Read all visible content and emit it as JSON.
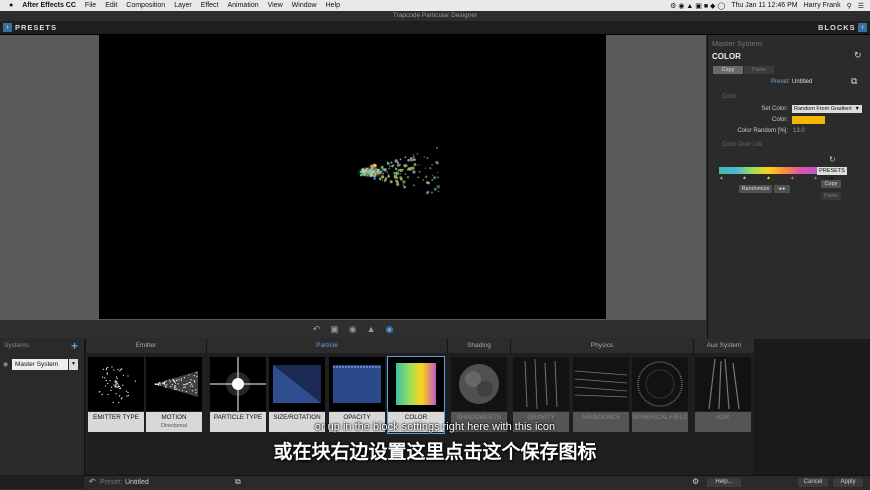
{
  "menubar": {
    "apple": "",
    "app_name": "After Effects CC",
    "items": [
      "File",
      "Edit",
      "Composition",
      "Layer",
      "Effect",
      "Animation",
      "View",
      "Window",
      "Help"
    ],
    "clock": "Thu Jan 11  12:46 PM",
    "user": "Harry Frank"
  },
  "window": {
    "title": "Trapcode Particular Designer"
  },
  "header": {
    "presets_label": "PRESETS",
    "blocks_label": "BLOCKS"
  },
  "right_panel": {
    "system_title": "Master System",
    "section_title": "COLOR",
    "copy_label": "Copy",
    "paste_label": "Paste",
    "preset_label": "Preset:",
    "preset_value": "Untitled",
    "color_section": "Color",
    "set_color_label": "Set Color:",
    "set_color_value": "Random From Gradient",
    "color_label": "Color:",
    "color_swatch": "#f2b705",
    "color_random_label": "Color Random [%]:",
    "color_random_value": "13.0",
    "col_over_life": "Color Over Life",
    "presets_dropdown": "PRESETS",
    "copy2_label": "Copy",
    "paste2_label": "Paste",
    "randomize_label": "Randomize",
    "swap_label": "◂ ▸"
  },
  "systems": {
    "title": "Systems",
    "add": "+",
    "item": "Master System"
  },
  "groups": [
    {
      "label": "Emitter"
    },
    {
      "label": "Particle"
    },
    {
      "label": "Shading"
    },
    {
      "label": "Physics"
    },
    {
      "label": "Aux System"
    }
  ],
  "blocks": [
    {
      "name": "EMITTER TYPE",
      "sub": ""
    },
    {
      "name": "MOTION",
      "sub": "Directional"
    },
    {
      "name": "PARTICLE TYPE",
      "sub": ""
    },
    {
      "name": "SIZE/ROTATION",
      "sub": ""
    },
    {
      "name": "OPACITY",
      "sub": ""
    },
    {
      "name": "COLOR",
      "sub": ""
    },
    {
      "name": "SHADOWLETS",
      "sub": "OFF"
    },
    {
      "name": "GRAVITY",
      "sub": "OFF"
    },
    {
      "name": "AIR/BOUNCE",
      "sub": "OFF"
    },
    {
      "name": "SPHERICAL FIELD",
      "sub": "OFF"
    },
    {
      "name": "AUX",
      "sub": "OFF"
    }
  ],
  "footer": {
    "preset_label": "Preset:",
    "preset_value": "Untitled",
    "help": "Help...",
    "cancel": "Cancel",
    "apply": "Apply"
  },
  "subtitles": {
    "en": "or up in the  block settings right here with this icon",
    "zh": "或在块右边设置这里点击这个保存图标"
  },
  "colors": {
    "accent": "#5aa0e0",
    "selected_group": "#5aa0e0"
  }
}
